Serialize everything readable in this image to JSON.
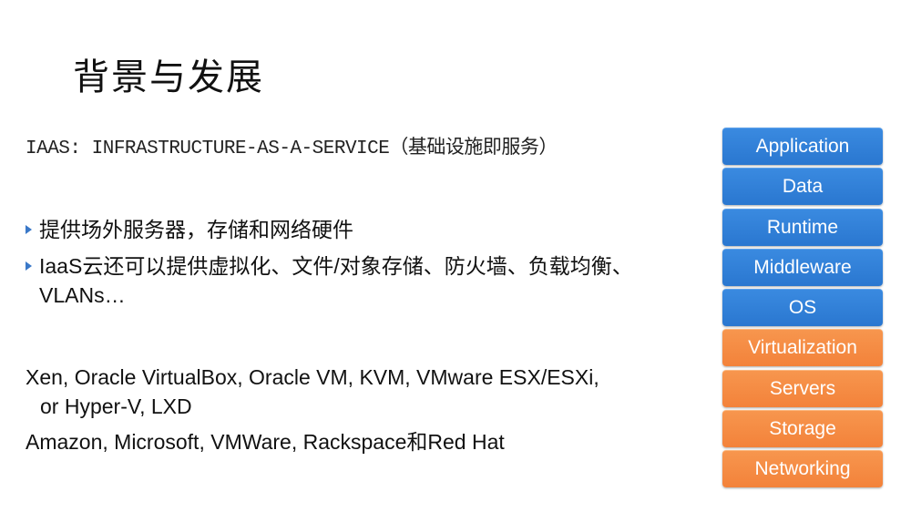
{
  "slide": {
    "title": "背景与发展",
    "subtitle": "IAAS: INFRASTRUCTURE-AS-A-SERVICE（基础设施即服务）",
    "bullets": [
      {
        "text": "提供场外服务器，存储和网络硬件"
      },
      {
        "text": "IaaS云还可以提供虚拟化、文件/对象存储、防火墙、负载均衡、VLANs…"
      }
    ],
    "paragraphs": {
      "hypervisors_line1": "Xen, Oracle VirtualBox, Oracle VM, KVM, VMware ESX/ESXi,",
      "hypervisors_line2": "or Hyper-V, LXD",
      "vendors": "Amazon, Microsoft, VMWare, Rackspace和Red Hat"
    }
  },
  "stack": {
    "colors": {
      "user_managed": "#2f7ed8",
      "provider_managed": "#f5893f"
    },
    "layers": [
      {
        "label": "Application",
        "managed_by": "user"
      },
      {
        "label": "Data",
        "managed_by": "user"
      },
      {
        "label": "Runtime",
        "managed_by": "user"
      },
      {
        "label": "Middleware",
        "managed_by": "user"
      },
      {
        "label": "OS",
        "managed_by": "user"
      },
      {
        "label": "Virtualization",
        "managed_by": "provider"
      },
      {
        "label": "Servers",
        "managed_by": "provider"
      },
      {
        "label": "Storage",
        "managed_by": "provider"
      },
      {
        "label": "Networking",
        "managed_by": "provider"
      }
    ]
  }
}
